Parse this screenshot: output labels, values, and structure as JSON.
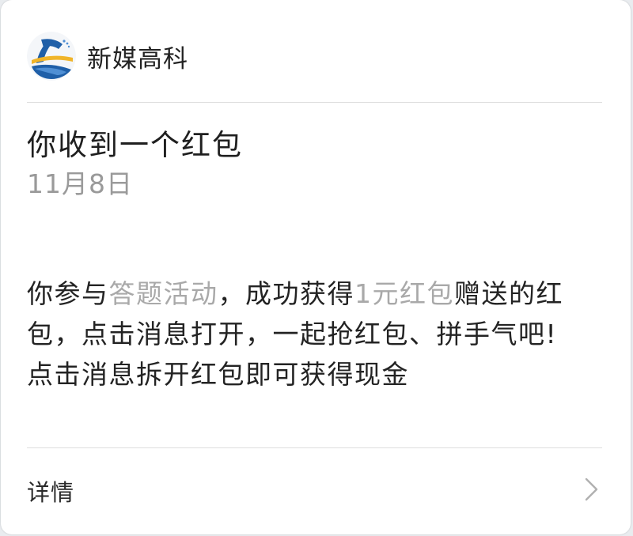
{
  "header": {
    "account_name": "新媒高科",
    "logo_icon": "wave-logo-icon"
  },
  "notification": {
    "title": "你收到一个红包",
    "date": "11月8日",
    "body": {
      "part1": "你参与",
      "activity_link": "答题活动",
      "part2": "，成功获得",
      "reward_link": "1元红包",
      "part3": "赠送的红包，点击消息打开，一起抢红包、拼手气吧!",
      "line2": "点击消息拆开红包即可获得现金"
    }
  },
  "footer": {
    "details_label": "详情",
    "chevron_icon": "chevron-right-icon"
  },
  "colors": {
    "background": "#ffffff",
    "text_primary": "#232323",
    "text_secondary": "#9a9a9a",
    "link_gray": "#a9a9a9",
    "logo_blue": "#1f5fa8",
    "logo_gold": "#f0b429"
  }
}
